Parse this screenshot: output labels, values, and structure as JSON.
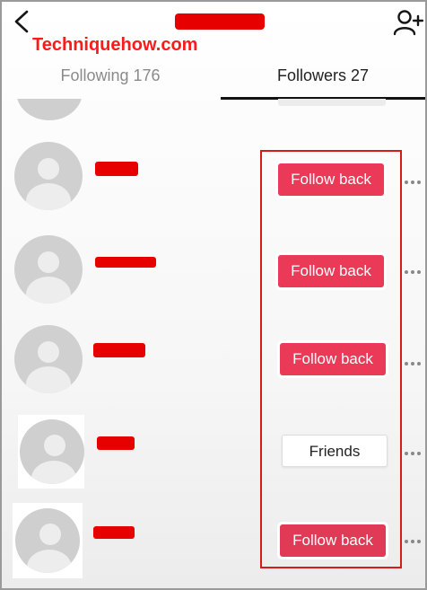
{
  "header": {
    "title_redacted": true,
    "back_icon": "chevron-left-icon",
    "add_user_icon": "add-user-icon"
  },
  "watermark": "Techniquehow.com",
  "tabs": [
    {
      "label": "Following 176",
      "active": false
    },
    {
      "label": "Followers 27",
      "active": true
    }
  ],
  "followers": [
    {
      "name_redacted": true,
      "action_label": "Follow back",
      "action_type": "follow"
    },
    {
      "name_redacted": true,
      "action_label": "Follow back",
      "action_type": "follow"
    },
    {
      "name_redacted": true,
      "action_label": "Follow back",
      "action_type": "follow"
    },
    {
      "name_redacted": true,
      "action_label": "Friends",
      "action_type": "friends"
    },
    {
      "name_redacted": true,
      "action_label": "Follow back",
      "action_type": "follow"
    }
  ],
  "colors": {
    "accent": "#ea3a58",
    "redaction": "#e60000",
    "highlight": "#d41c1c",
    "active_tab_text": "#222222",
    "inactive_tab_text": "#8a8a8a"
  }
}
